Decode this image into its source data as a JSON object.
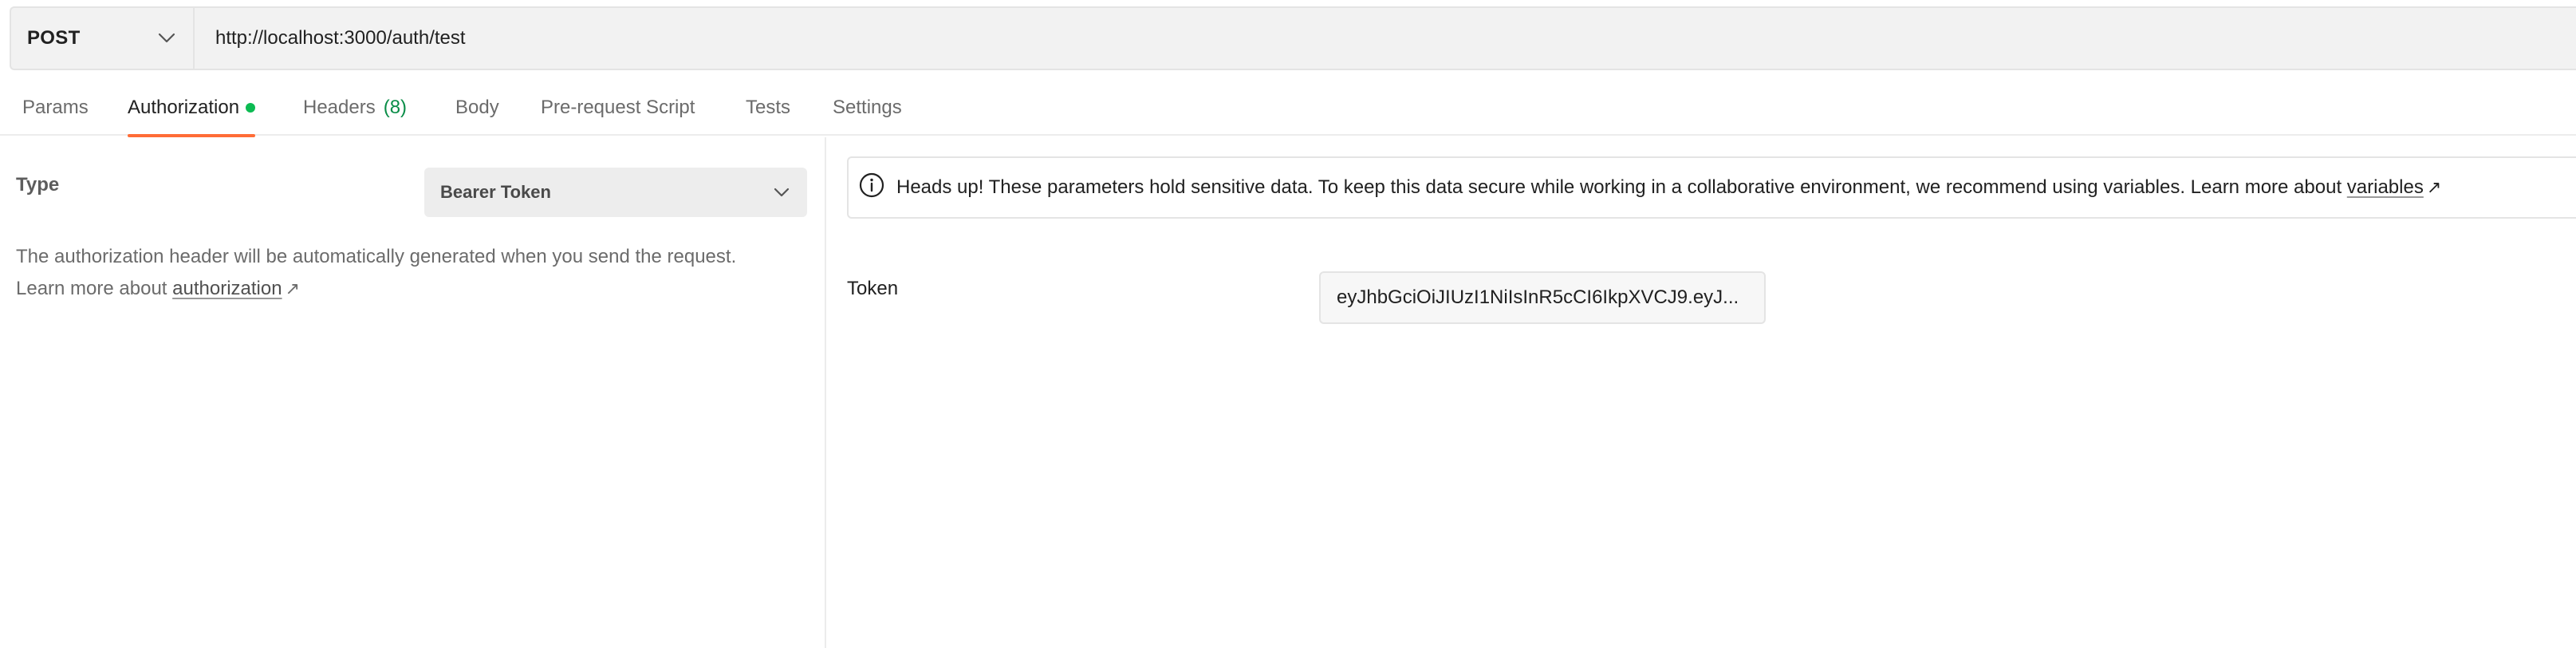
{
  "request": {
    "method": "POST",
    "url": "http://localhost:3000/auth/test"
  },
  "tabs": [
    {
      "label": "Params"
    },
    {
      "label": "Authorization",
      "active": true,
      "indicator": "green-dot"
    },
    {
      "label": "Headers",
      "count": "(8)"
    },
    {
      "label": "Body"
    },
    {
      "label": "Pre-request Script"
    },
    {
      "label": "Tests"
    },
    {
      "label": "Settings"
    }
  ],
  "auth": {
    "type_label": "Type",
    "type_value": "Bearer Token",
    "helper_text": "The authorization header will be automatically generated when you send the request. Learn more about",
    "helper_link": "authorization",
    "link_arrow": "↗"
  },
  "banner": {
    "icon": "info-icon",
    "text": "Heads up! These parameters hold sensitive data. To keep this data secure while working in a collaborative environment, we recommend using variables. Learn more about",
    "link": "variables",
    "link_arrow": "↗"
  },
  "token": {
    "label": "Token",
    "value": "eyJhbGciOiJIUzI1NiIsInR5cCI6IkpXVCJ9.eyJ..."
  },
  "colors": {
    "accent": "#ff6c37",
    "active_dot": "#0cbb52",
    "count": "#0a8d48"
  }
}
